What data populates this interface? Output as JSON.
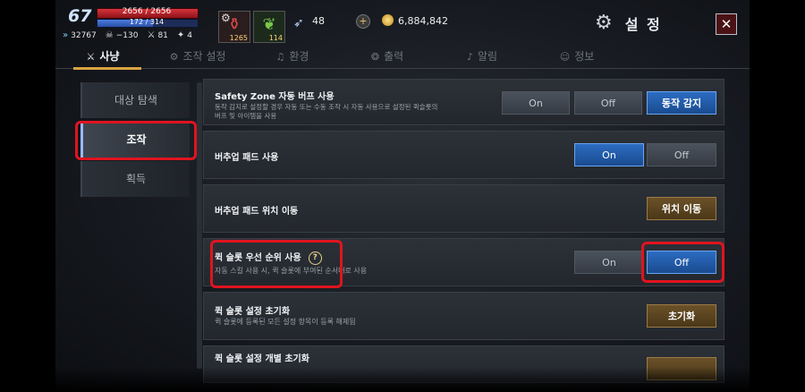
{
  "hud": {
    "level": "67",
    "hp": "2656 / 2656",
    "mp": "172 / 314",
    "mp_fraction": 0.55,
    "stats": [
      "32767",
      "−130",
      "81",
      "4"
    ],
    "items": [
      {
        "icon": "potion-icon",
        "count": "1265"
      },
      {
        "icon": "leaf-icon",
        "count": "114"
      }
    ],
    "wing_value": "48",
    "plus": "+",
    "gold": "6,884,842",
    "title": "설 정",
    "close": "✕"
  },
  "tabs": [
    {
      "label": "사냥",
      "icon": "crossed-swords-icon",
      "glyph": "⚔"
    },
    {
      "label": "조작 설정",
      "icon": "gear-icon",
      "glyph": "⚙"
    },
    {
      "label": "환경",
      "icon": "music-icon",
      "glyph": "♫"
    },
    {
      "label": "출력",
      "icon": "output-icon",
      "glyph": "❂"
    },
    {
      "label": "알림",
      "icon": "bell-icon",
      "glyph": "♪"
    },
    {
      "label": "정보",
      "icon": "user-icon",
      "glyph": "☺"
    }
  ],
  "left_menu": [
    "대상 탐색",
    "조작",
    "획득"
  ],
  "rows": {
    "safety": {
      "label": "Safety Zone 자동 버프 사용",
      "desc": "동작 감지로 설정할 경우 자동 또는 수동 조작 시 자동 사용으로 설정된 퀵슬롯의\n버프 및 아이템을 사용",
      "on": "On",
      "off": "Off",
      "detect": "동작 감지"
    },
    "buffpad": {
      "label": "버추업 패드 사용",
      "on": "On",
      "off": "Off"
    },
    "padpos": {
      "label": "버추업 패드 위치 이동",
      "button": "위치 이동"
    },
    "quickprio": {
      "label": "퀵 슬롯 우선 순위 사용",
      "help": "?",
      "desc": "자동 스킬 사용 시, 퀵 슬롯에 부여된 순서대로 사용",
      "on": "On",
      "off": "Off"
    },
    "reset": {
      "label": "퀵 슬롯 설정 초기화",
      "desc": "퀵 슬롯에 등록된 모든 설정 항목이 등록 해제됨",
      "button": "초기화"
    },
    "reset_each": {
      "label": "퀵 슬롯 설정 개별 초기화"
    }
  },
  "colors": {
    "accent": "#d9a441",
    "on_blue": "#2c6cc2",
    "highlight": "#e0141f"
  }
}
